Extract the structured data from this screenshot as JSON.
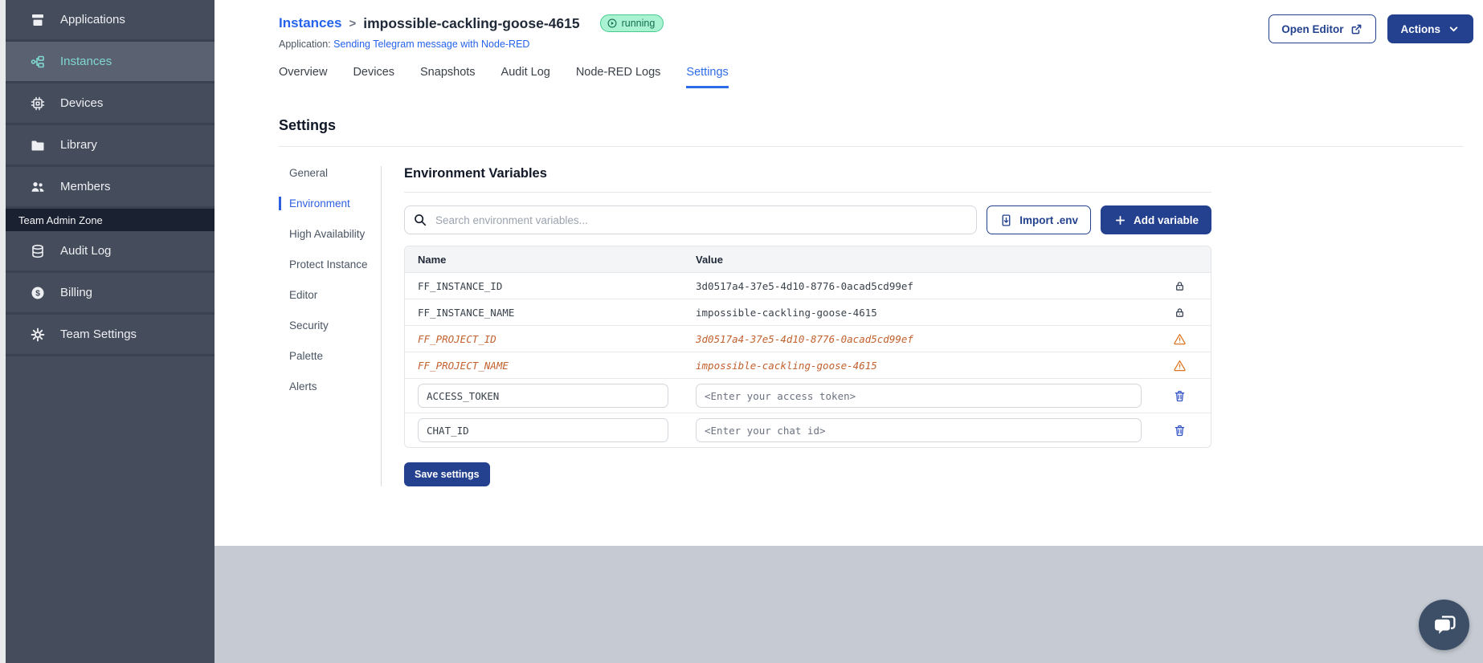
{
  "sidebar": {
    "items": [
      {
        "label": "Applications",
        "icon": "applications",
        "active": false
      },
      {
        "label": "Instances",
        "icon": "instances",
        "active": true
      },
      {
        "label": "Devices",
        "icon": "devices",
        "active": false
      },
      {
        "label": "Library",
        "icon": "library",
        "active": false
      },
      {
        "label": "Members",
        "icon": "members",
        "active": false
      }
    ],
    "admin_zone_label": "Team Admin Zone",
    "admin_items": [
      {
        "label": "Audit Log",
        "icon": "audit",
        "active": false
      },
      {
        "label": "Billing",
        "icon": "billing",
        "active": false
      },
      {
        "label": "Team Settings",
        "icon": "gear",
        "active": false
      }
    ]
  },
  "header": {
    "breadcrumb_parent": "Instances",
    "separator": ">",
    "title": "impossible-cackling-goose-4615",
    "status": "running",
    "application_label": "Application:",
    "application_link": "Sending Telegram message with Node-RED",
    "open_editor_label": "Open Editor",
    "actions_label": "Actions"
  },
  "tabs": [
    {
      "label": "Overview",
      "active": false
    },
    {
      "label": "Devices",
      "active": false
    },
    {
      "label": "Snapshots",
      "active": false
    },
    {
      "label": "Audit Log",
      "active": false
    },
    {
      "label": "Node-RED Logs",
      "active": false
    },
    {
      "label": "Settings",
      "active": true
    }
  ],
  "settings": {
    "page_title": "Settings",
    "nav": [
      {
        "label": "General",
        "active": false
      },
      {
        "label": "Environment",
        "active": true
      },
      {
        "label": "High Availability",
        "active": false
      },
      {
        "label": "Protect Instance",
        "active": false
      },
      {
        "label": "Editor",
        "active": false
      },
      {
        "label": "Security",
        "active": false
      },
      {
        "label": "Palette",
        "active": false
      },
      {
        "label": "Alerts",
        "active": false
      }
    ],
    "panel_title": "Environment Variables",
    "search_placeholder": "Search environment variables...",
    "import_button": "Import .env",
    "add_button": "Add variable",
    "save_button": "Save settings",
    "table": {
      "columns": [
        "Name",
        "Value",
        ""
      ],
      "rows": [
        {
          "name": "FF_INSTANCE_ID",
          "value": "3d0517a4-37e5-4d10-8776-0acad5cd99ef",
          "type": "locked",
          "icon": "lock-icon"
        },
        {
          "name": "FF_INSTANCE_NAME",
          "value": "impossible-cackling-goose-4615",
          "type": "locked",
          "icon": "lock-icon"
        },
        {
          "name": "FF_PROJECT_ID",
          "value": "3d0517a4-37e5-4d10-8776-0acad5cd99ef",
          "type": "deprecated",
          "icon": "warning-icon"
        },
        {
          "name": "FF_PROJECT_NAME",
          "value": "impossible-cackling-goose-4615",
          "type": "deprecated",
          "icon": "warning-icon"
        },
        {
          "name": "ACCESS_TOKEN",
          "value": "<Enter your access token>",
          "type": "editable",
          "icon": "trash-icon"
        },
        {
          "name": "CHAT_ID",
          "value": "<Enter your chat id>",
          "type": "editable",
          "icon": "trash-icon"
        }
      ]
    }
  },
  "colors": {
    "sidebar_bg": "#454c5b",
    "sidebar_active_bg": "#5a6170",
    "sidebar_teal": "#7fd8cf",
    "admin_band_bg": "#1a2231",
    "link_blue": "#2563eb",
    "button_blue": "#24418f",
    "running_bg": "#a9f2d2",
    "running_border": "#47c98f",
    "running_text": "#156f4b",
    "deprecated_orange": "#c2612e",
    "trash_blue": "#3353c6",
    "bottom_band": "#c5cad3"
  }
}
